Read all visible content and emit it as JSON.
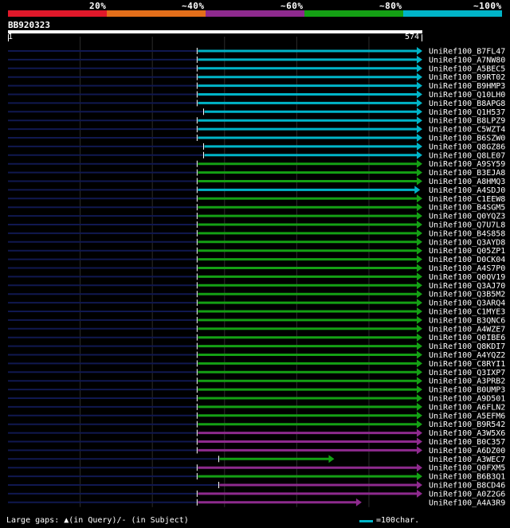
{
  "scale": {
    "labels": [
      "20%",
      "~40%",
      "~60%",
      "~80%",
      "~100%"
    ],
    "colors": [
      "#e0182a",
      "#e36e1a",
      "#8e2a8e",
      "#14a014",
      "#00b4c8"
    ]
  },
  "query": {
    "id": "BB920323",
    "start": "1",
    "end": "574",
    "length": 574
  },
  "colors": {
    "cyan": "#00b4c8",
    "green": "#14a014",
    "purple": "#8e2a8e",
    "background_line": "#101850",
    "grid": "#2b2b2b"
  },
  "hits": [
    {
      "name": "UniRef100_B7FL47",
      "color": "cyan",
      "start": 262,
      "end": 574
    },
    {
      "name": "UniRef100_A7NW80",
      "color": "cyan",
      "start": 262,
      "end": 574
    },
    {
      "name": "UniRef100_A5BEC5",
      "color": "cyan",
      "start": 262,
      "end": 574
    },
    {
      "name": "UniRef100_B9RT02",
      "color": "cyan",
      "start": 262,
      "end": 574
    },
    {
      "name": "UniRef100_B9HMP3",
      "color": "cyan",
      "start": 262,
      "end": 574
    },
    {
      "name": "UniRef100_Q10LH0",
      "color": "cyan",
      "start": 262,
      "end": 574
    },
    {
      "name": "UniRef100_B8APG8",
      "color": "cyan",
      "start": 262,
      "end": 574
    },
    {
      "name": "UniRef100_Q1H537",
      "color": "cyan",
      "start": 271,
      "end": 574
    },
    {
      "name": "UniRef100_B8LPZ9",
      "color": "cyan",
      "start": 262,
      "end": 574
    },
    {
      "name": "UniRef100_C5WZT4",
      "color": "cyan",
      "start": 262,
      "end": 574
    },
    {
      "name": "UniRef100_B6SZW0",
      "color": "cyan",
      "start": 262,
      "end": 574
    },
    {
      "name": "UniRef100_Q8GZ86",
      "color": "cyan",
      "start": 271,
      "end": 574
    },
    {
      "name": "UniRef100_Q8LE07",
      "color": "cyan",
      "start": 271,
      "end": 574
    },
    {
      "name": "UniRef100_A9SY59",
      "color": "green",
      "start": 262,
      "end": 574
    },
    {
      "name": "UniRef100_B3EJA8",
      "color": "green",
      "start": 262,
      "end": 574
    },
    {
      "name": "UniRef100_A8HMQ3",
      "color": "green",
      "start": 262,
      "end": 574
    },
    {
      "name": "UniRef100_A4SDJ0",
      "color": "cyan",
      "start": 262,
      "end": 571
    },
    {
      "name": "UniRef100_C1EEW8",
      "color": "green",
      "start": 262,
      "end": 574
    },
    {
      "name": "UniRef100_B4SGM5",
      "color": "green",
      "start": 262,
      "end": 574
    },
    {
      "name": "UniRef100_Q0YQZ3",
      "color": "green",
      "start": 262,
      "end": 574
    },
    {
      "name": "UniRef100_Q7U7L8",
      "color": "green",
      "start": 262,
      "end": 574
    },
    {
      "name": "UniRef100_B4S858",
      "color": "green",
      "start": 262,
      "end": 574
    },
    {
      "name": "UniRef100_Q3AYD8",
      "color": "green",
      "start": 262,
      "end": 574
    },
    {
      "name": "UniRef100_Q05ZP1",
      "color": "green",
      "start": 262,
      "end": 574
    },
    {
      "name": "UniRef100_D0CK04",
      "color": "green",
      "start": 262,
      "end": 574
    },
    {
      "name": "UniRef100_A4S7P0",
      "color": "green",
      "start": 262,
      "end": 574
    },
    {
      "name": "UniRef100_Q0QV19",
      "color": "green",
      "start": 262,
      "end": 574
    },
    {
      "name": "UniRef100_Q3AJ70",
      "color": "green",
      "start": 262,
      "end": 574
    },
    {
      "name": "UniRef100_Q3B5M2",
      "color": "green",
      "start": 262,
      "end": 574
    },
    {
      "name": "UniRef100_Q3ARQ4",
      "color": "green",
      "start": 262,
      "end": 574
    },
    {
      "name": "UniRef100_C1MYE3",
      "color": "green",
      "start": 262,
      "end": 574
    },
    {
      "name": "UniRef100_B3QNC6",
      "color": "green",
      "start": 262,
      "end": 574
    },
    {
      "name": "UniRef100_A4WZE7",
      "color": "green",
      "start": 262,
      "end": 574
    },
    {
      "name": "UniRef100_Q0IBE6",
      "color": "green",
      "start": 262,
      "end": 574
    },
    {
      "name": "UniRef100_Q8KDI7",
      "color": "green",
      "start": 262,
      "end": 574
    },
    {
      "name": "UniRef100_A4YQZ2",
      "color": "green",
      "start": 262,
      "end": 574
    },
    {
      "name": "UniRef100_C8RYI1",
      "color": "green",
      "start": 262,
      "end": 574
    },
    {
      "name": "UniRef100_Q3IXP7",
      "color": "green",
      "start": 262,
      "end": 574
    },
    {
      "name": "UniRef100_A3PRB2",
      "color": "green",
      "start": 262,
      "end": 574
    },
    {
      "name": "UniRef100_B0UMP3",
      "color": "green",
      "start": 262,
      "end": 574
    },
    {
      "name": "UniRef100_A9D501",
      "color": "green",
      "start": 262,
      "end": 574
    },
    {
      "name": "UniRef100_A6FLN2",
      "color": "green",
      "start": 262,
      "end": 574
    },
    {
      "name": "UniRef100_A5EFM6",
      "color": "green",
      "start": 262,
      "end": 574
    },
    {
      "name": "UniRef100_B9R542",
      "color": "green",
      "start": 262,
      "end": 574
    },
    {
      "name": "UniRef100_A3W5X6",
      "color": "purple",
      "start": 262,
      "end": 574
    },
    {
      "name": "UniRef100_B0C357",
      "color": "purple",
      "start": 262,
      "end": 574
    },
    {
      "name": "UniRef100_A6DZ00",
      "color": "purple",
      "start": 262,
      "end": 574
    },
    {
      "name": "UniRef100_A3WEC7",
      "color": "green",
      "start": 292,
      "end": 452
    },
    {
      "name": "UniRef100_Q0FXM5",
      "color": "purple",
      "start": 262,
      "end": 574
    },
    {
      "name": "UniRef100_B6B3Q1",
      "color": "green",
      "start": 262,
      "end": 574
    },
    {
      "name": "UniRef100_B8CD46",
      "color": "purple",
      "start": 292,
      "end": 574
    },
    {
      "name": "UniRef100_A0Z2G6",
      "color": "purple",
      "start": 262,
      "end": 574
    },
    {
      "name": "UniRef100_A4A3R9",
      "color": "purple",
      "start": 262,
      "end": 490
    }
  ],
  "footer": {
    "gaps_text": "Large gaps: ▲(in Query)/- (in Subject)",
    "legend_text": "=100char."
  }
}
